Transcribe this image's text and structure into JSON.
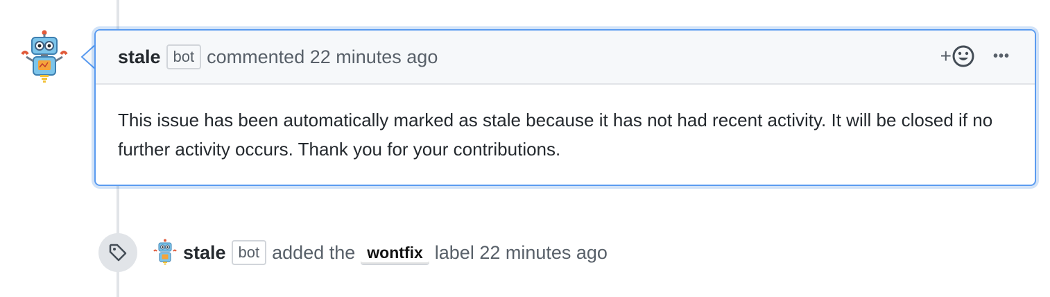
{
  "comment": {
    "author": "stale",
    "bot_label": "bot",
    "action_text": "commented 22 minutes ago",
    "reaction_plus": "+",
    "more_options": "•••",
    "body": "This issue has been automatically marked as stale because it has not had recent activity. It will be closed if no further activity occurs. Thank you for your contributions."
  },
  "event": {
    "author": "stale",
    "bot_label": "bot",
    "action_text": "added the",
    "label": "wontfix",
    "suffix_text": "label 22 minutes ago"
  },
  "icons": {
    "avatar": "robot-avatar-icon",
    "emoji": "smiley-icon",
    "more": "kebab-horizontal-icon",
    "tag": "tag-icon"
  },
  "colors": {
    "focus_border": "#5a9bf0",
    "header_bg": "#f6f8fa",
    "timeline": "#e1e4e8"
  }
}
